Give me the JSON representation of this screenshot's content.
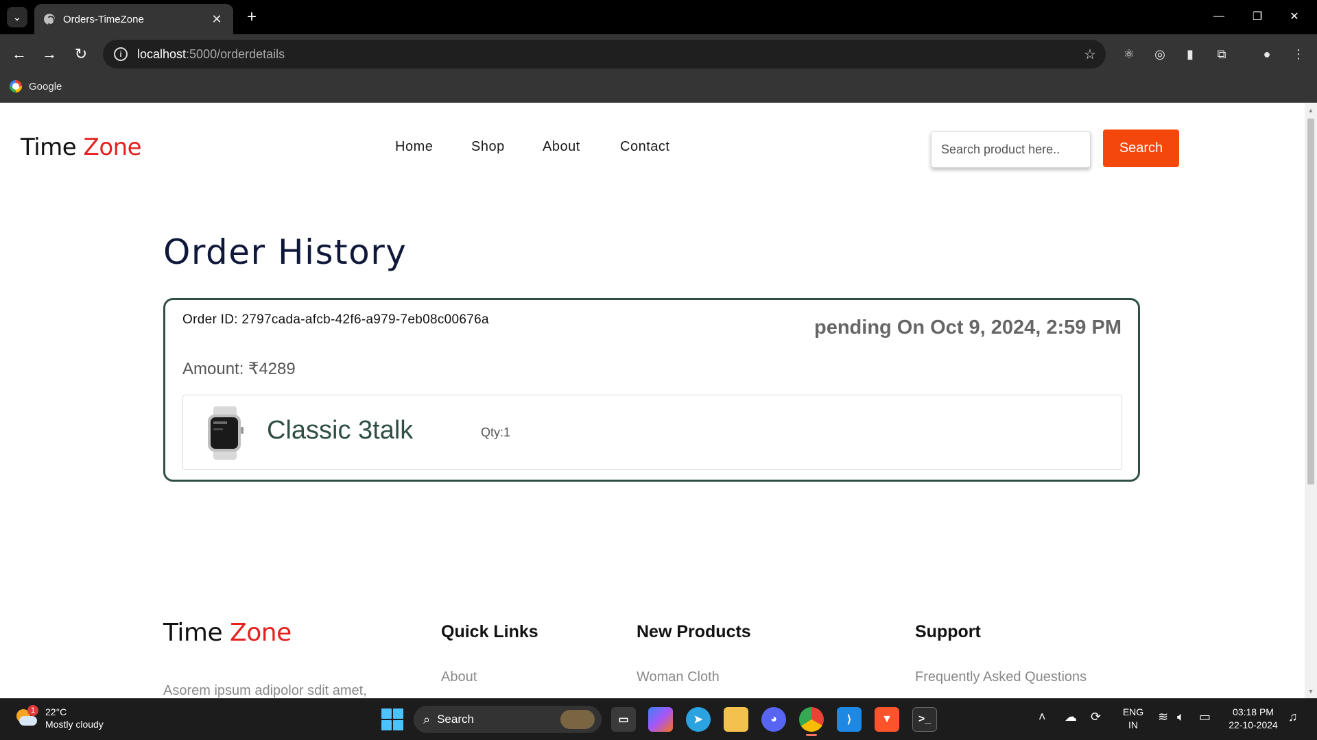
{
  "browser": {
    "tab_title": "Orders-TimeZone",
    "tab_close": "✕",
    "new_tab": "+",
    "url_host": "localhost",
    "url_path": ":5000/orderdetails",
    "bookmark_label": "Google"
  },
  "site": {
    "logo_part1": "Time",
    "logo_part2": "Zone",
    "nav": [
      "Home",
      "Shop",
      "About",
      "Contact"
    ],
    "search_placeholder": "Search product here..",
    "search_button": "Search"
  },
  "orders": {
    "title": "Order History",
    "items": [
      {
        "order_id": "Order ID: 2797cada-afcb-42f6-a979-7eb08c00676a",
        "status": "pending On Oct 9, 2024, 2:59 PM",
        "amount": "Amount: ₹4289",
        "product_name": "Classic 3talk",
        "qty": "Qty:1"
      }
    ]
  },
  "footer": {
    "logo_part1": "Time",
    "logo_part2": "Zone",
    "description": "Asorem ipsum adipolor sdit amet,",
    "columns": [
      {
        "heading": "Quick Links",
        "first_link": "About"
      },
      {
        "heading": "New Products",
        "first_link": "Woman Cloth"
      },
      {
        "heading": "Support",
        "first_link": "Frequently Asked Questions"
      }
    ]
  },
  "taskbar": {
    "weather_badge": "1",
    "temperature": "22°C",
    "condition": "Mostly cloudy",
    "search_label": "Search",
    "lang_line1": "ENG",
    "lang_line2": "IN",
    "time": "03:18 PM",
    "date": "22-10-2024"
  },
  "colors": {
    "accent_orange": "#f4470b",
    "logo_red": "#e5201f",
    "card_border": "#2f4f46",
    "title_navy": "#10183a"
  }
}
